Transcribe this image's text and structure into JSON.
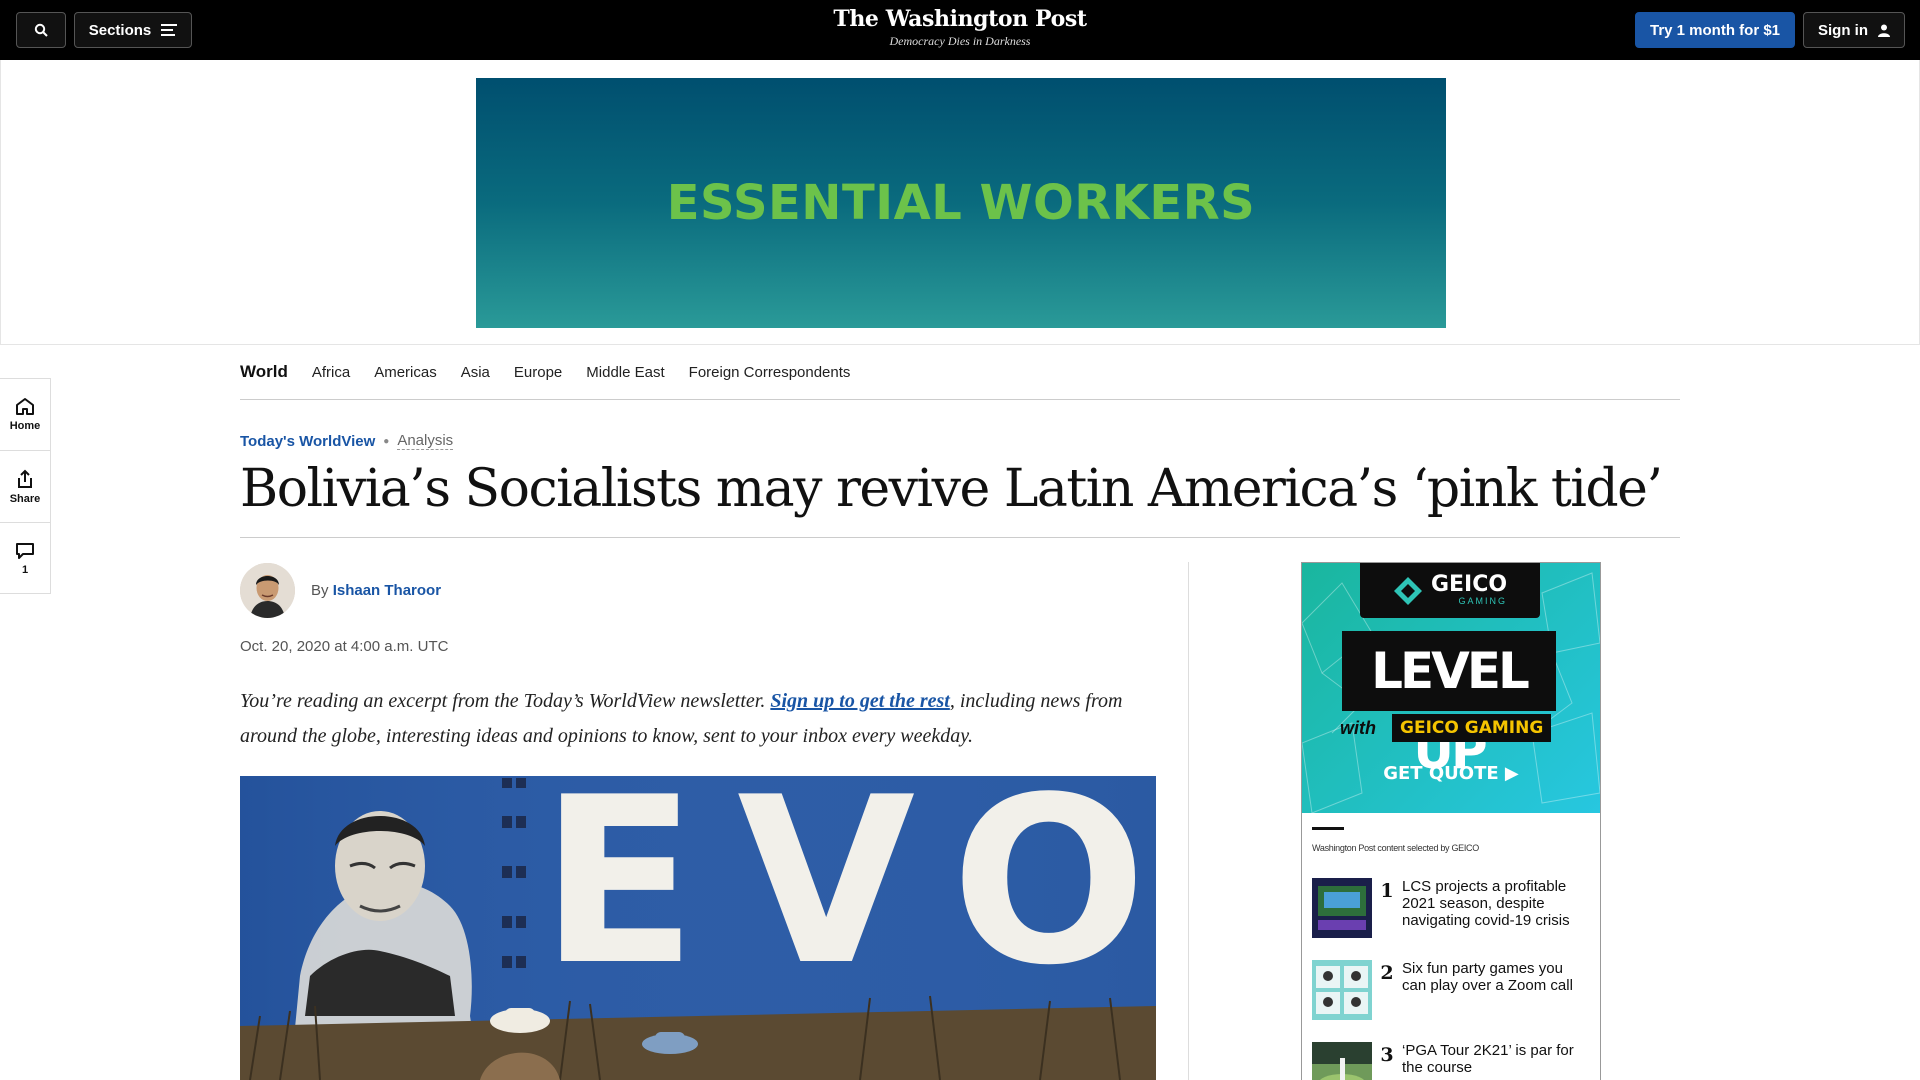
{
  "topbar": {
    "sections_label": "Sections",
    "logo": "The Washington Post",
    "tagline": "Democracy Dies in Darkness",
    "trial_label": "Try 1 month for $1",
    "signin_label": "Sign in"
  },
  "banner": {
    "text": "ESSENTIAL WORKERS"
  },
  "rail": {
    "home": "Home",
    "share": "Share",
    "comments": "1"
  },
  "secnav": {
    "current": "World",
    "items": [
      "Africa",
      "Americas",
      "Asia",
      "Europe",
      "Middle East",
      "Foreign Correspondents"
    ]
  },
  "article": {
    "series": "Today's WorldView",
    "label": "Analysis",
    "headline": "Bolivia’s Socialists may revive Latin America’s ‘pink tide’",
    "by": "By",
    "author": "Ishaan Tharoor",
    "date": "Oct. 20, 2020 at 4:00 a.m. UTC",
    "intro_before": "You’re reading an excerpt from the Today’s WorldView newsletter. ",
    "intro_link": "Sign up to get the rest",
    "intro_after": ", including news from around the globe, interesting ideas and opinions to know, sent to your inbox every weekday.",
    "photo_mural_text": "EVO"
  },
  "sidead": {
    "brand": "GEICO",
    "brand_sub": "GAMING",
    "headline": "LEVEL UP",
    "with": "with",
    "with_brand": "GEICO GAMING",
    "cta": "GET QUOTE ▶",
    "selected_by": "Washington Post content selected by GEICO",
    "promos": [
      {
        "num": "1",
        "text": "LCS projects a profitable 2021 season, despite navigating covid-19 crisis"
      },
      {
        "num": "2",
        "text": "Six fun party games you can play over a Zoom call"
      },
      {
        "num": "3",
        "text": "‘PGA Tour 2K21’ is par for the course"
      }
    ]
  },
  "colors": {
    "link_blue": "#1955a5",
    "ad_green": "#6cc24a"
  }
}
